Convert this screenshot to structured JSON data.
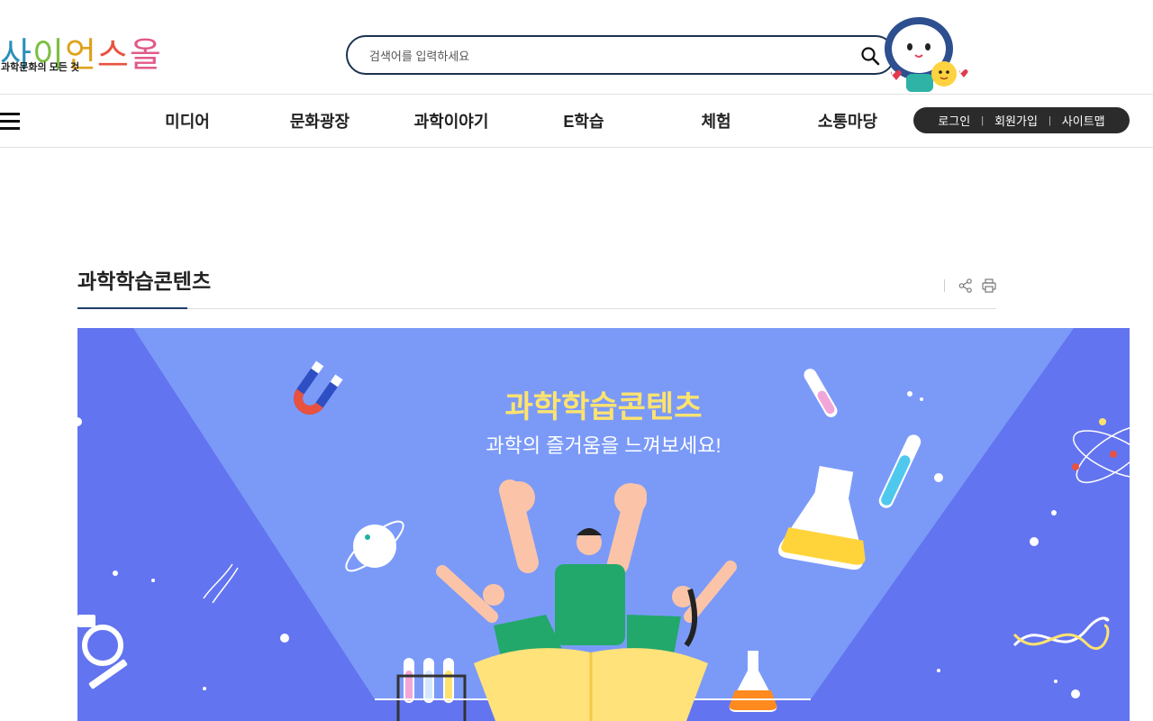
{
  "header": {
    "logo_text": "사이언스올",
    "logo_subtitle": "과학문화의 모든 것",
    "search_placeholder": "검색어를 입력하세요"
  },
  "nav": {
    "menu": [
      "미디어",
      "문화광장",
      "과학이야기",
      "E학습",
      "체험",
      "소통마당"
    ],
    "utility": {
      "login": "로그인",
      "signup": "회원가입",
      "sitemap": "사이트맵",
      "separator": "|"
    }
  },
  "page": {
    "title": "과학학습콘텐츠"
  },
  "banner": {
    "title": "과학학습콘텐츠",
    "subtitle": "과학의 즐거움을 느껴보세요!",
    "colors": {
      "background": "#6374f0",
      "spotlight": "#7b9af8",
      "title": "#ffe36e"
    }
  },
  "colors": {
    "search_border": "#1c3350",
    "utility_bg": "#2b2b2b",
    "title_accent": "#1f3f6b"
  }
}
